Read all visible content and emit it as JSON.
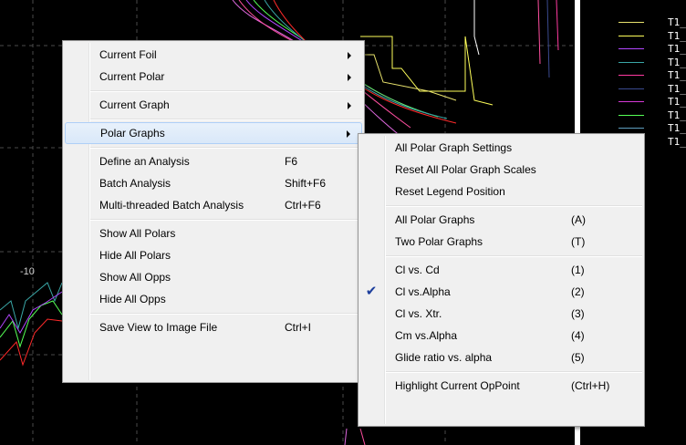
{
  "plot": {
    "x_tick_label": "-10"
  },
  "legend": {
    "items": [
      {
        "label": "T1_",
        "color": "#e9e36d"
      },
      {
        "label": "T1_",
        "color": "#ffff5a"
      },
      {
        "label": "T1_",
        "color": "#b247ff"
      },
      {
        "label": "T1_",
        "color": "#3aa7a7"
      },
      {
        "label": "T1_",
        "color": "#ff3aa0"
      },
      {
        "label": "T1_",
        "color": "#3a4a8f"
      },
      {
        "label": "T1_",
        "color": "#d63ad6"
      },
      {
        "label": "T1_",
        "color": "#55ff55"
      },
      {
        "label": "T1_",
        "color": "#5f9fbf"
      },
      {
        "label": "T1_",
        "color": "#ff2a2a"
      }
    ]
  },
  "context_menu": {
    "items": [
      {
        "label": "Current Foil",
        "submenu": true
      },
      {
        "label": "Current Polar",
        "submenu": true
      },
      {
        "separator": true
      },
      {
        "label": "Current Graph",
        "submenu": true
      },
      {
        "separator": true
      },
      {
        "label": "Polar Graphs",
        "submenu": true,
        "highlighted": true
      },
      {
        "separator": true
      },
      {
        "label": "Define an Analysis",
        "shortcut": "F6"
      },
      {
        "label": "Batch Analysis",
        "shortcut": "Shift+F6"
      },
      {
        "label": "Multi-threaded Batch Analysis",
        "shortcut": "Ctrl+F6"
      },
      {
        "separator": true
      },
      {
        "label": "Show All Polars"
      },
      {
        "label": "Hide All Polars"
      },
      {
        "label": "Show All Opps"
      },
      {
        "label": "Hide All Opps"
      },
      {
        "separator": true
      },
      {
        "label": "Save View to Image File",
        "shortcut": "Ctrl+I"
      }
    ]
  },
  "submenu": {
    "items": [
      {
        "label": "All Polar Graph Settings"
      },
      {
        "label": "Reset All Polar Graph Scales"
      },
      {
        "label": "Reset Legend Position"
      },
      {
        "separator": true
      },
      {
        "label": "All Polar Graphs",
        "shortcut": "(A)"
      },
      {
        "label": "Two Polar Graphs",
        "shortcut": "(T)"
      },
      {
        "separator": true
      },
      {
        "label": "Cl vs. Cd",
        "shortcut": "(1)"
      },
      {
        "label": "Cl vs.Alpha",
        "shortcut": "(2)",
        "checked": true
      },
      {
        "label": "Cl vs. Xtr.",
        "shortcut": "(3)"
      },
      {
        "label": "Cm vs.Alpha",
        "shortcut": "(4)"
      },
      {
        "label": "Glide ratio vs. alpha",
        "shortcut": "(5)"
      },
      {
        "separator": true
      },
      {
        "label": "Highlight Current OpPoint",
        "shortcut": "(Ctrl+H)"
      }
    ]
  },
  "colors": {
    "menu_background": "#f0f0f0",
    "highlight": "#d9e8f9",
    "check_mark": "#1c3e9c",
    "plot_background": "#000000"
  }
}
